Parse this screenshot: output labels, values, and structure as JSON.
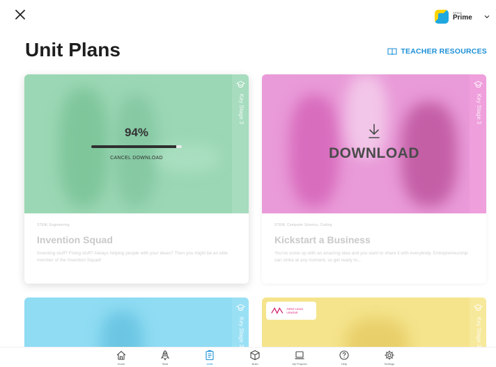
{
  "header": {
    "app_name_small": "SPIKE",
    "app_name": "Prime"
  },
  "page": {
    "title": "Unit Plans",
    "teacher_resources": "TEACHER RESOURCES"
  },
  "cards": [
    {
      "tags": "STEM, Engineering",
      "title": "Invention Squad",
      "description": "Inventing stuff? Fixing stuff? Always helping people with your ideas? Then you might be an elite member of the Invention Squad!",
      "stage": "Key Stage 3",
      "download_progress_text": "94%",
      "download_progress": 0.94,
      "cancel_label": "CANCEL DOWNLOAD"
    },
    {
      "tags": "STEM, Computer Science, Coding",
      "title": "Kickstart a Business",
      "description": "You've come up with an amazing idea and you want to share it with everybody. Entrepreneurship can strike at any moment, so get ready to...",
      "stage": "Key Stage 3",
      "download_label": "DOWNLOAD"
    },
    {
      "stage": "Key Stage 3"
    },
    {
      "stage": "Key Stage 3",
      "badge": "FIRST LEGO LEAGUE"
    }
  ],
  "nav": [
    {
      "label": "Home",
      "icon": "home-icon"
    },
    {
      "label": "Start",
      "icon": "rocket-icon"
    },
    {
      "label": "Units",
      "icon": "clipboard-icon",
      "active": true
    },
    {
      "label": "Build",
      "icon": "cube-icon"
    },
    {
      "label": "My Projects",
      "icon": "laptop-icon"
    },
    {
      "label": "Help",
      "icon": "help-icon"
    },
    {
      "label": "Settings",
      "icon": "gear-icon"
    }
  ],
  "colors": {
    "accent": "#1b8fd6",
    "card1": "#9bd7b4",
    "card2": "#e99ad8",
    "card3": "#8fdcf3",
    "card4": "#f5e48c"
  }
}
